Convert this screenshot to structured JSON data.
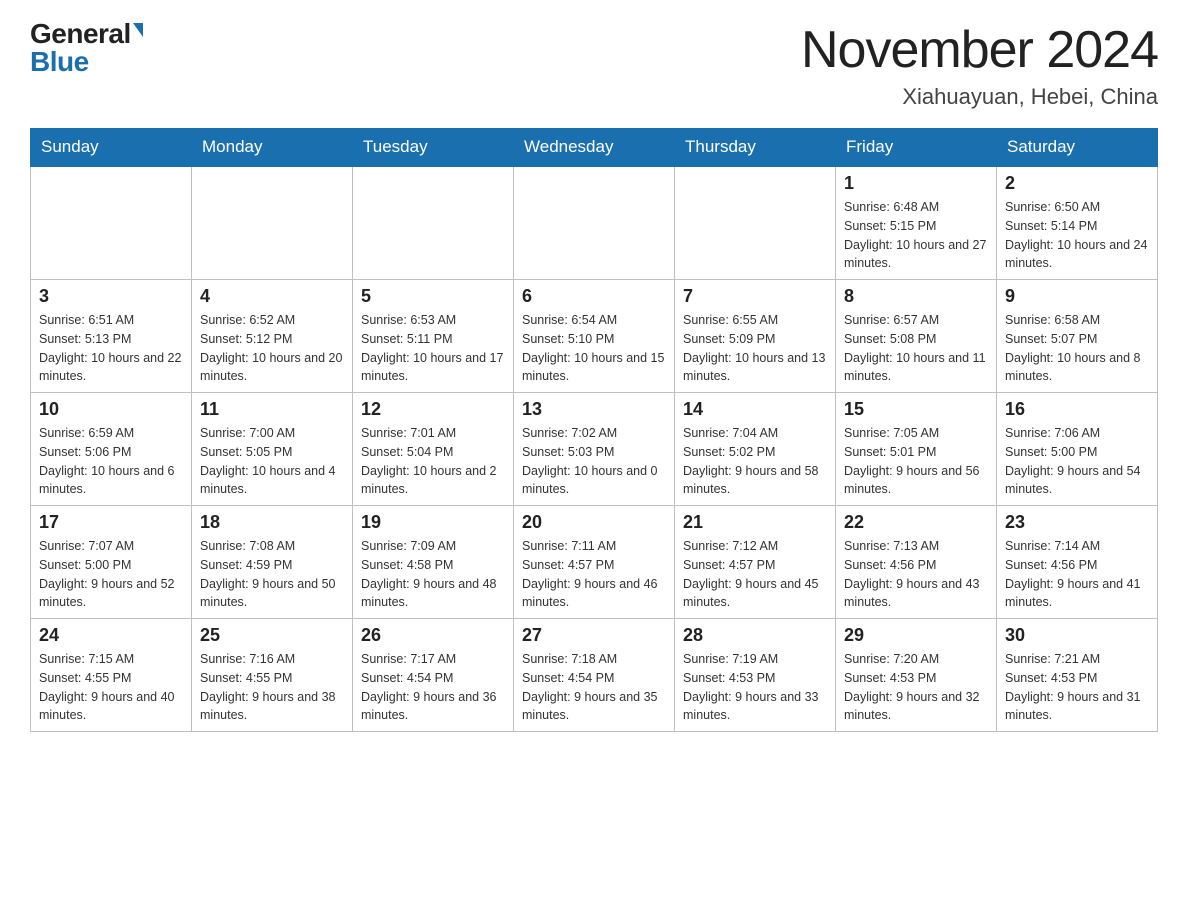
{
  "header": {
    "logo_general": "General",
    "logo_blue": "Blue",
    "month_year": "November 2024",
    "location": "Xiahuayuan, Hebei, China"
  },
  "weekdays": [
    "Sunday",
    "Monday",
    "Tuesday",
    "Wednesday",
    "Thursday",
    "Friday",
    "Saturday"
  ],
  "weeks": [
    [
      {
        "day": "",
        "detail": ""
      },
      {
        "day": "",
        "detail": ""
      },
      {
        "day": "",
        "detail": ""
      },
      {
        "day": "",
        "detail": ""
      },
      {
        "day": "",
        "detail": ""
      },
      {
        "day": "1",
        "detail": "Sunrise: 6:48 AM\nSunset: 5:15 PM\nDaylight: 10 hours and 27 minutes."
      },
      {
        "day": "2",
        "detail": "Sunrise: 6:50 AM\nSunset: 5:14 PM\nDaylight: 10 hours and 24 minutes."
      }
    ],
    [
      {
        "day": "3",
        "detail": "Sunrise: 6:51 AM\nSunset: 5:13 PM\nDaylight: 10 hours and 22 minutes."
      },
      {
        "day": "4",
        "detail": "Sunrise: 6:52 AM\nSunset: 5:12 PM\nDaylight: 10 hours and 20 minutes."
      },
      {
        "day": "5",
        "detail": "Sunrise: 6:53 AM\nSunset: 5:11 PM\nDaylight: 10 hours and 17 minutes."
      },
      {
        "day": "6",
        "detail": "Sunrise: 6:54 AM\nSunset: 5:10 PM\nDaylight: 10 hours and 15 minutes."
      },
      {
        "day": "7",
        "detail": "Sunrise: 6:55 AM\nSunset: 5:09 PM\nDaylight: 10 hours and 13 minutes."
      },
      {
        "day": "8",
        "detail": "Sunrise: 6:57 AM\nSunset: 5:08 PM\nDaylight: 10 hours and 11 minutes."
      },
      {
        "day": "9",
        "detail": "Sunrise: 6:58 AM\nSunset: 5:07 PM\nDaylight: 10 hours and 8 minutes."
      }
    ],
    [
      {
        "day": "10",
        "detail": "Sunrise: 6:59 AM\nSunset: 5:06 PM\nDaylight: 10 hours and 6 minutes."
      },
      {
        "day": "11",
        "detail": "Sunrise: 7:00 AM\nSunset: 5:05 PM\nDaylight: 10 hours and 4 minutes."
      },
      {
        "day": "12",
        "detail": "Sunrise: 7:01 AM\nSunset: 5:04 PM\nDaylight: 10 hours and 2 minutes."
      },
      {
        "day": "13",
        "detail": "Sunrise: 7:02 AM\nSunset: 5:03 PM\nDaylight: 10 hours and 0 minutes."
      },
      {
        "day": "14",
        "detail": "Sunrise: 7:04 AM\nSunset: 5:02 PM\nDaylight: 9 hours and 58 minutes."
      },
      {
        "day": "15",
        "detail": "Sunrise: 7:05 AM\nSunset: 5:01 PM\nDaylight: 9 hours and 56 minutes."
      },
      {
        "day": "16",
        "detail": "Sunrise: 7:06 AM\nSunset: 5:00 PM\nDaylight: 9 hours and 54 minutes."
      }
    ],
    [
      {
        "day": "17",
        "detail": "Sunrise: 7:07 AM\nSunset: 5:00 PM\nDaylight: 9 hours and 52 minutes."
      },
      {
        "day": "18",
        "detail": "Sunrise: 7:08 AM\nSunset: 4:59 PM\nDaylight: 9 hours and 50 minutes."
      },
      {
        "day": "19",
        "detail": "Sunrise: 7:09 AM\nSunset: 4:58 PM\nDaylight: 9 hours and 48 minutes."
      },
      {
        "day": "20",
        "detail": "Sunrise: 7:11 AM\nSunset: 4:57 PM\nDaylight: 9 hours and 46 minutes."
      },
      {
        "day": "21",
        "detail": "Sunrise: 7:12 AM\nSunset: 4:57 PM\nDaylight: 9 hours and 45 minutes."
      },
      {
        "day": "22",
        "detail": "Sunrise: 7:13 AM\nSunset: 4:56 PM\nDaylight: 9 hours and 43 minutes."
      },
      {
        "day": "23",
        "detail": "Sunrise: 7:14 AM\nSunset: 4:56 PM\nDaylight: 9 hours and 41 minutes."
      }
    ],
    [
      {
        "day": "24",
        "detail": "Sunrise: 7:15 AM\nSunset: 4:55 PM\nDaylight: 9 hours and 40 minutes."
      },
      {
        "day": "25",
        "detail": "Sunrise: 7:16 AM\nSunset: 4:55 PM\nDaylight: 9 hours and 38 minutes."
      },
      {
        "day": "26",
        "detail": "Sunrise: 7:17 AM\nSunset: 4:54 PM\nDaylight: 9 hours and 36 minutes."
      },
      {
        "day": "27",
        "detail": "Sunrise: 7:18 AM\nSunset: 4:54 PM\nDaylight: 9 hours and 35 minutes."
      },
      {
        "day": "28",
        "detail": "Sunrise: 7:19 AM\nSunset: 4:53 PM\nDaylight: 9 hours and 33 minutes."
      },
      {
        "day": "29",
        "detail": "Sunrise: 7:20 AM\nSunset: 4:53 PM\nDaylight: 9 hours and 32 minutes."
      },
      {
        "day": "30",
        "detail": "Sunrise: 7:21 AM\nSunset: 4:53 PM\nDaylight: 9 hours and 31 minutes."
      }
    ]
  ]
}
